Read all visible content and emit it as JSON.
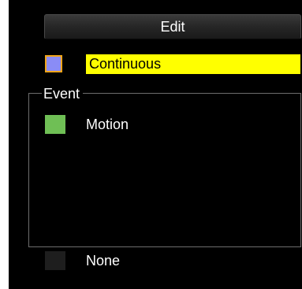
{
  "edit_button": {
    "label": "Edit"
  },
  "schedule": {
    "continuous": {
      "label": "Continuous",
      "color": "#8a8cf6",
      "border_color": "#f0a51a",
      "highlight": "#ffff00"
    },
    "event_group": {
      "title": "Event",
      "items": [
        {
          "label": "Motion",
          "color": "#6fbf55"
        }
      ]
    },
    "none": {
      "label": "None",
      "color": "#1e1e1e"
    }
  }
}
